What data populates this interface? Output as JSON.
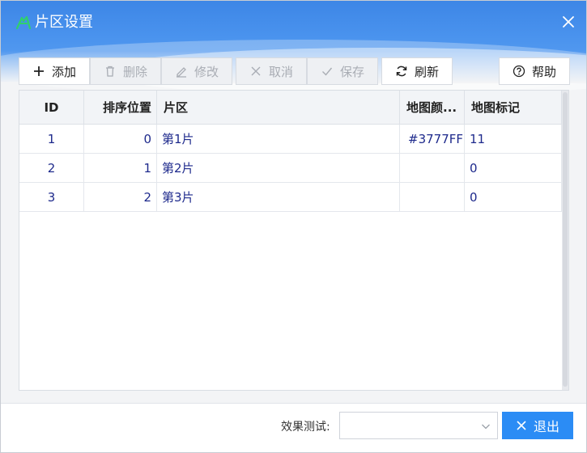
{
  "window": {
    "title": "片区设置",
    "colors": {
      "title_bar": "#4a93ee",
      "accent": "#2b8cf5",
      "icon_green": "#2fd16b",
      "cell_text": "#1e2a8c"
    }
  },
  "toolbar": {
    "add": "添加",
    "delete": "删除",
    "edit": "修改",
    "cancel": "取消",
    "save": "保存",
    "refresh": "刷新",
    "help": "帮助"
  },
  "table": {
    "columns": [
      "ID",
      "排序位置",
      "片区",
      "地图颜...",
      "地图标记"
    ],
    "rows": [
      {
        "id": "1",
        "sort": "0",
        "area": "第1片",
        "color": "#3777FF",
        "marker": "11"
      },
      {
        "id": "2",
        "sort": "1",
        "area": "第2片",
        "color": "",
        "marker": "0"
      },
      {
        "id": "3",
        "sort": "2",
        "area": "第3片",
        "color": "",
        "marker": "0"
      }
    ]
  },
  "footer": {
    "effect_label": "效果测试:",
    "effect_value": "",
    "exit": "退出"
  }
}
